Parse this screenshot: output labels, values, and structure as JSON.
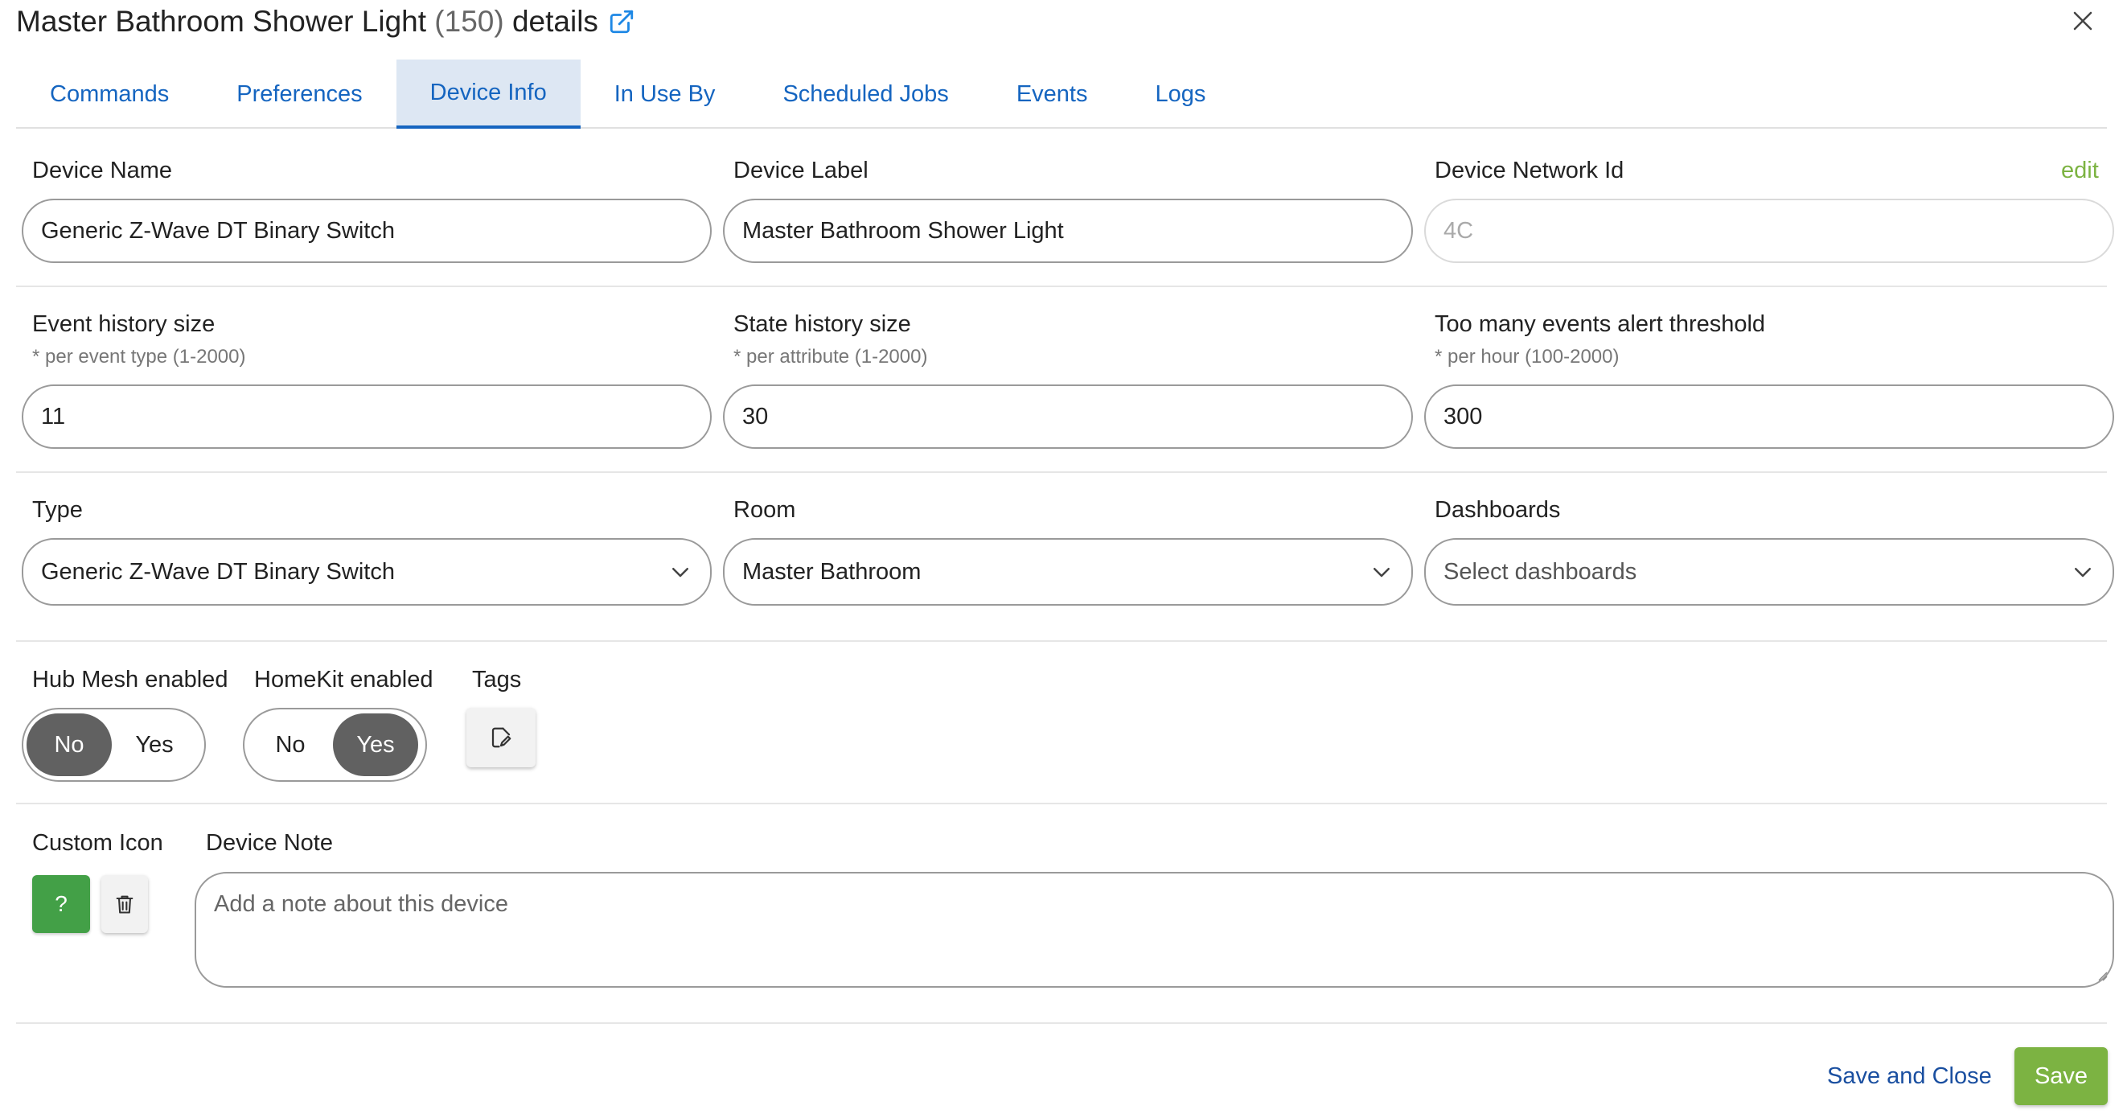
{
  "dialog": {
    "title_name": "Master Bathroom Shower Light",
    "title_count": "(150)",
    "title_suffix": "details"
  },
  "tabs": [
    {
      "label": "Commands"
    },
    {
      "label": "Preferences"
    },
    {
      "label": "Device Info"
    },
    {
      "label": "In Use By"
    },
    {
      "label": "Scheduled Jobs"
    },
    {
      "label": "Events"
    },
    {
      "label": "Logs"
    }
  ],
  "active_tab": "Device Info",
  "device": {
    "name_label": "Device Name",
    "name_value": "Generic Z-Wave DT Binary Switch",
    "device_label_label": "Device Label",
    "device_label_value": "Master Bathroom Shower Light",
    "network_id_label": "Device Network Id",
    "network_id_value": "4C",
    "edit_link": "edit"
  },
  "history": {
    "event_label": "Event history size",
    "event_hint": "* per event type (1-2000)",
    "event_value": "11",
    "state_label": "State history size",
    "state_hint": "* per attribute (1-2000)",
    "state_value": "30",
    "alert_label": "Too many events alert threshold",
    "alert_hint": "* per hour (100-2000)",
    "alert_value": "300"
  },
  "selects": {
    "type_label": "Type",
    "type_value": "Generic Z-Wave DT Binary Switch",
    "room_label": "Room",
    "room_value": "Master Bathroom",
    "dashboards_label": "Dashboards",
    "dashboards_placeholder": "Select dashboards"
  },
  "toggles": {
    "hub_mesh_label": "Hub Mesh enabled",
    "hub_mesh_no": "No",
    "hub_mesh_yes": "Yes",
    "hub_mesh_selected": "No",
    "homekit_label": "HomeKit enabled",
    "homekit_no": "No",
    "homekit_yes": "Yes",
    "homekit_selected": "Yes",
    "tags_label": "Tags"
  },
  "notes": {
    "custom_icon_label": "Custom Icon",
    "custom_icon_glyph": "?",
    "device_note_label": "Device Note",
    "device_note_placeholder": "Add a note about this device"
  },
  "footer": {
    "save_and_close": "Save and Close",
    "save": "Save"
  },
  "colors": {
    "link_blue": "#1565c0",
    "active_tab_bg": "#dde7f3",
    "green_primary": "#7cb342",
    "green_icon": "#43a047",
    "toggle_on": "#616161"
  }
}
